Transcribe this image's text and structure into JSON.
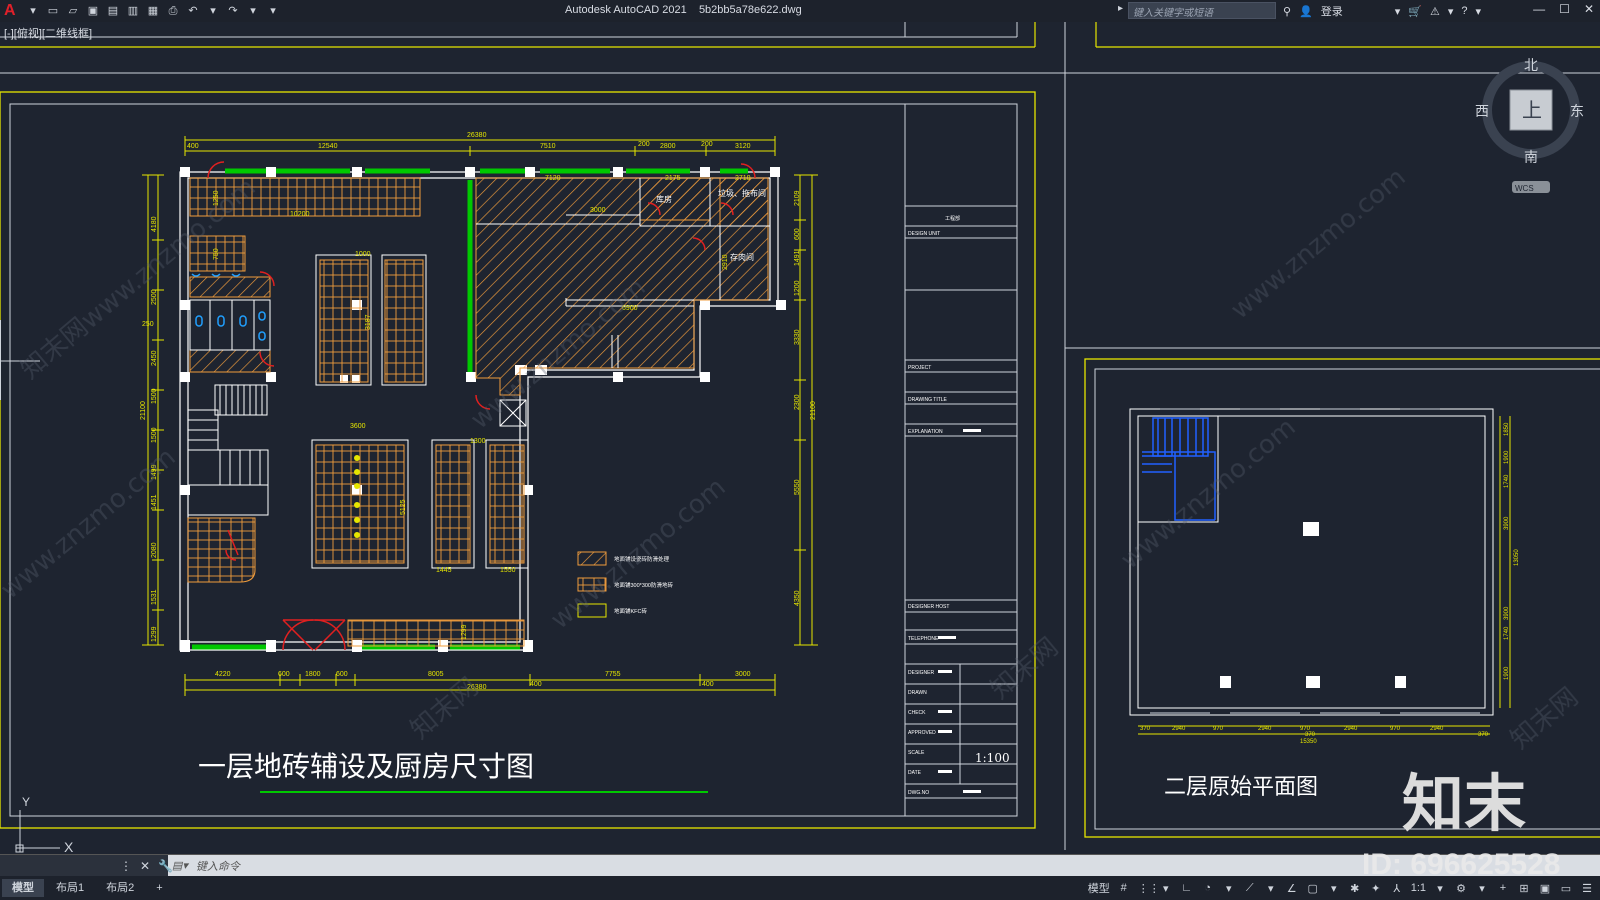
{
  "titlebar": {
    "app_name": "Autodesk AutoCAD 2021",
    "file_name": "5b2bb5a78e622.dwg",
    "search_placeholder": "键入关键字或短语",
    "login_label": "登录"
  },
  "viewport_label": "[-][俯视][二维线框]",
  "viewcube": {
    "north": "北",
    "south": "南",
    "east": "东",
    "west": "西",
    "face": "上",
    "wcs": "WCS"
  },
  "drawing1": {
    "title": "一层地砖辅设及厨房尺寸图",
    "rooms": {
      "storage": "库房",
      "trash": "垃圾、拖布间",
      "pantry": "存肉间"
    },
    "dims_top": [
      "12540",
      "7510",
      "26380",
      "400",
      "200",
      "2800",
      "200",
      "3120",
      "7120",
      "2175",
      "2710",
      "10200",
      "3000",
      "6900"
    ],
    "dims_bottom": [
      "4220",
      "600",
      "1800",
      "600",
      "8005",
      "7755",
      "3000",
      "400",
      "400",
      "26380"
    ],
    "dims_left": [
      "4180",
      "2500",
      "250",
      "2450",
      "1500",
      "1500",
      "1499",
      "1451",
      "2080",
      "1531",
      "1299",
      "21100"
    ],
    "dims_right": [
      "2109",
      "600",
      "1491",
      "1200",
      "3330",
      "2300",
      "21100",
      "5550",
      "4350"
    ],
    "dims_inner": [
      "1000",
      "3187",
      "3600",
      "1300",
      "5125",
      "1445",
      "1550",
      "1299",
      "1250",
      "750",
      "2910"
    ],
    "legend": [
      "地面铺设瓷砖防滑处理",
      "地面铺300*300防滑地砖",
      "地面铺KFC砖"
    ]
  },
  "titleblock": {
    "company": "工程部",
    "design_unit": "DESIGN UNIT",
    "project": "PROJECT",
    "drawing_title": "DRAWING TITLE",
    "explanation": "EXPLANATION",
    "designer_host": "DESIGNER HOST",
    "telephone": "TELEPHONE",
    "designer": "DESIGNER",
    "drawn": "DRAWN",
    "check": "CHECK",
    "approved": "APPROVED",
    "scale_label": "SCALE",
    "scale_value": "1:100",
    "date": "DATE",
    "dwg_no": "DWG.NO"
  },
  "drawing2": {
    "title": "二层原始平面图",
    "dims_bottom": [
      "370",
      "2940",
      "970",
      "2940",
      "970",
      "2940",
      "970",
      "2940",
      "370",
      "370",
      "15350"
    ],
    "dims_right": [
      "1850",
      "1900",
      "1740",
      "3900",
      "13050",
      "3900",
      "1740",
      "1900"
    ]
  },
  "watermark": {
    "site": "www.znzmo.com",
    "brand": "知末网",
    "logo": "知末",
    "id": "ID: 696625528"
  },
  "command": {
    "placeholder": "键入命令"
  },
  "layout_tabs": [
    "模型",
    "布局1",
    "布局2"
  ],
  "status": {
    "model": "模型",
    "scale": "1:1"
  },
  "colors": {
    "yellow": "#e6e600",
    "green": "#00c800",
    "orange": "#f09c3c",
    "red": "#e02020",
    "white": "#ffffff",
    "blue": "#2060ff",
    "bg": "#1e2430"
  }
}
